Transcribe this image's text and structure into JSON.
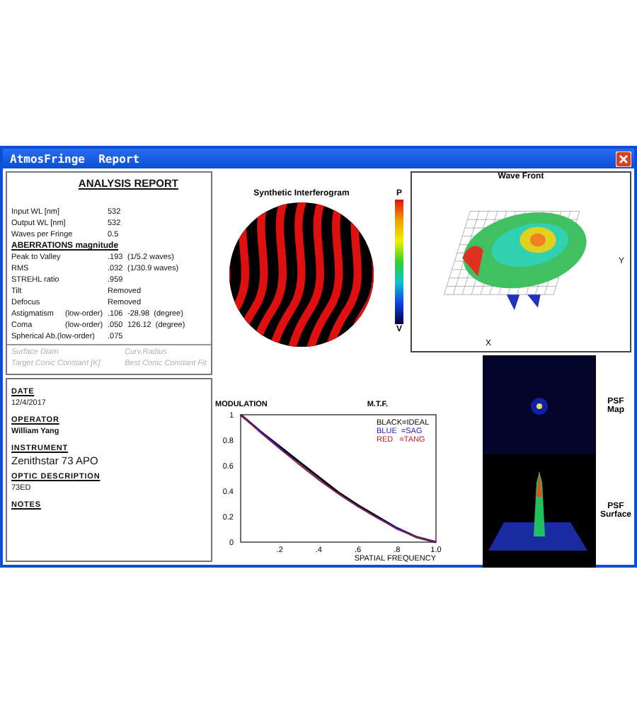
{
  "window": {
    "title": "AtmosFringe  Report"
  },
  "report": {
    "title": "ANALYSIS  REPORT",
    "parameters": [
      {
        "label": "Input WL [nm]",
        "value": "532"
      },
      {
        "label": "Output WL [nm]",
        "value": "532"
      },
      {
        "label": "Waves per Fringe",
        "value": "0.5"
      }
    ],
    "aberrations_heading": "ABERRATIONS magnitude",
    "aberrations": [
      {
        "label": "Peak to Valley",
        "value": ".193",
        "note": "(1/5.2 waves)"
      },
      {
        "label": "RMS",
        "value": ".032",
        "note": "(1/30.9 waves)"
      },
      {
        "label": "STREHL ratio",
        "value": ".959"
      },
      {
        "label": "Tilt",
        "value": "Removed"
      },
      {
        "label": "Defocus",
        "value": "Removed"
      },
      {
        "label": "Astigmatism",
        "qualifier": "(low-order)",
        "value": ".106",
        "note": "-28.98  (degree)"
      },
      {
        "label": "Coma",
        "qualifier": "(low-order)",
        "value": ".050",
        "note": "126.12  (degree)"
      },
      {
        "label": "Spherical Ab.(low-order)",
        "value": ".075"
      }
    ],
    "optional_fields": [
      {
        "label": "Surface Diam",
        "disabled": true
      },
      {
        "label": "Curv.Radius",
        "disabled": true
      },
      {
        "label": "Target Conic Constant [K]",
        "disabled": true
      },
      {
        "label": "Best Conic Constant Fit",
        "disabled": true
      }
    ]
  },
  "info": [
    {
      "heading": "DATE",
      "value": "12/4/2017",
      "kind": "plain"
    },
    {
      "heading": "OPERATOR",
      "value": "William Yang",
      "kind": "name"
    },
    {
      "heading": "INSTRUMENT",
      "value": "Zenithstar 73 APO",
      "kind": "instrument"
    },
    {
      "heading": "OPTIC DESCRIPTION",
      "value": "73ED",
      "kind": "plain"
    },
    {
      "heading": "NOTES"
    }
  ],
  "interferogram": {
    "title": "Synthetic Interferogram",
    "scale_top": "P",
    "scale_bottom": "V"
  },
  "wave_front": {
    "title": "Wave Front",
    "axis_x": "X",
    "axis_y": "Y"
  },
  "psf": [
    {
      "kind": "map",
      "label": "PSF Map"
    },
    {
      "kind": "surface",
      "label": "PSF Surface"
    }
  ],
  "mtf": {
    "title": "M.T.F.",
    "chart_data": {
      "type": "line",
      "ylabel": "MODULATION",
      "xlabel": "SPATIAL FREQUENCY",
      "x": [
        0,
        0.1,
        0.2,
        0.3,
        0.4,
        0.5,
        0.6,
        0.7,
        0.8,
        0.9,
        1.0
      ],
      "series": [
        {
          "name": "BLACK=IDEAL",
          "color": "#000000",
          "values": [
            1,
            0.87,
            0.75,
            0.63,
            0.51,
            0.39,
            0.29,
            0.2,
            0.11,
            0.04,
            0
          ]
        },
        {
          "name": "BLUE  =SAG",
          "color": "#2020c0",
          "values": [
            1,
            0.87,
            0.74,
            0.61,
            0.49,
            0.38,
            0.28,
            0.19,
            0.11,
            0.04,
            0
          ]
        },
        {
          "name": "RED   =TANG",
          "color": "#c02020",
          "values": [
            1,
            0.86,
            0.73,
            0.61,
            0.49,
            0.38,
            0.28,
            0.19,
            0.1,
            0.04,
            0
          ]
        }
      ],
      "xlim": [
        0,
        1
      ],
      "ylim": [
        0,
        1
      ],
      "xticks": [
        {
          "value": 0.2,
          "label": ".2"
        },
        {
          "value": 0.4,
          "label": ".4"
        },
        {
          "value": 0.6,
          "label": ".6"
        },
        {
          "value": 0.8,
          "label": ".8"
        },
        {
          "value": 1.0,
          "label": "1.0"
        }
      ],
      "yticks": [
        0,
        {
          "value": 0.2,
          "label": "0.2"
        },
        {
          "value": 0.4,
          "label": "0.4"
        },
        {
          "value": 0.6,
          "label": "0.6"
        },
        {
          "value": 0.8,
          "label": "0.8"
        },
        1
      ]
    }
  }
}
